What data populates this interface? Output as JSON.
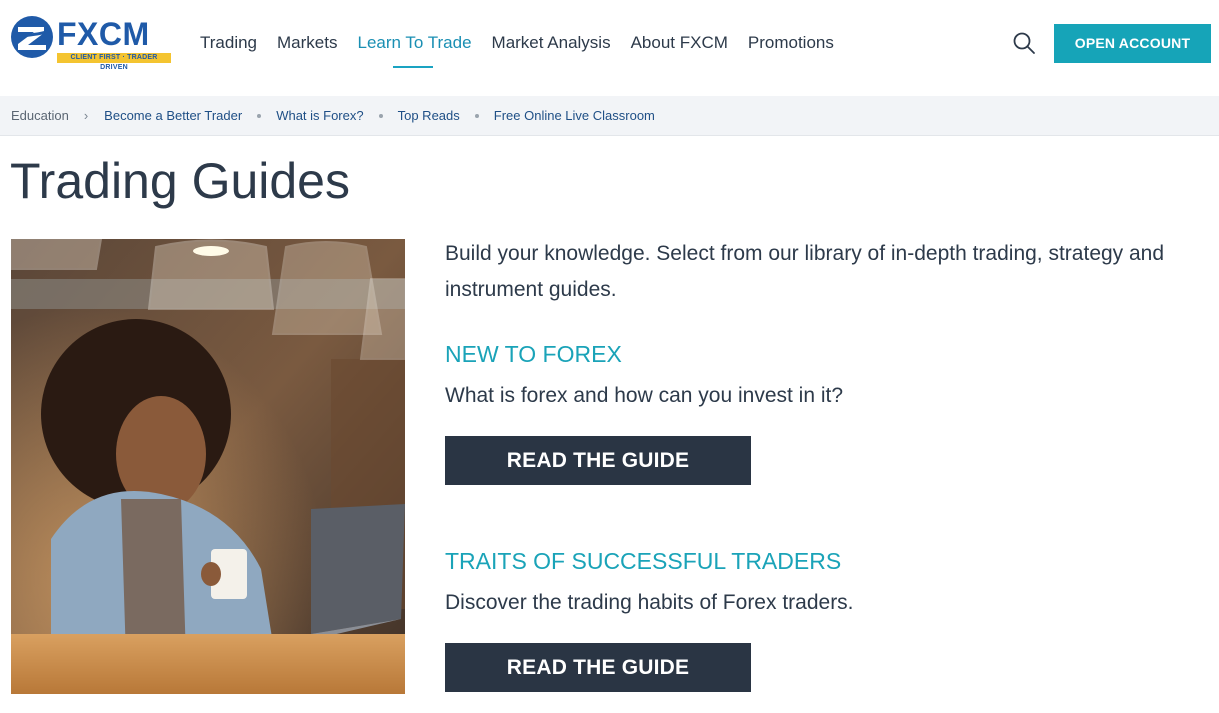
{
  "brand": {
    "name": "FXCM",
    "tagline": "CLIENT FIRST · TRADER DRIVEN",
    "colors": {
      "primary": "#1f5aa8",
      "accent": "#16a4b8",
      "dark_button": "#2a3544",
      "tagline_bg": "#f4c430"
    }
  },
  "nav": {
    "items": [
      {
        "label": "Trading"
      },
      {
        "label": "Markets"
      },
      {
        "label": "Learn To Trade",
        "active": true
      },
      {
        "label": "Market Analysis"
      },
      {
        "label": "About FXCM"
      },
      {
        "label": "Promotions"
      }
    ],
    "search_icon": "search-icon",
    "cta_label": "OPEN ACCOUNT"
  },
  "breadcrumb": {
    "home": "Education",
    "separator_icon": "chevron-right-icon",
    "links": [
      {
        "label": "Become a Better Trader"
      },
      {
        "label": "What is Forex?"
      },
      {
        "label": "Top Reads"
      },
      {
        "label": "Free Online Live Classroom"
      }
    ]
  },
  "page": {
    "title": "Trading Guides",
    "intro": "Build your knowledge. Select from our library of in-depth trading, strategy and instrument guides.",
    "sections": [
      {
        "title": "NEW TO FOREX",
        "description": "What is forex and how can you invest in it?",
        "button_label": "READ THE GUIDE"
      },
      {
        "title": "TRAITS OF SUCCESSFUL TRADERS",
        "description": "Discover the trading habits of Forex traders.",
        "button_label": "READ THE GUIDE"
      }
    ]
  }
}
